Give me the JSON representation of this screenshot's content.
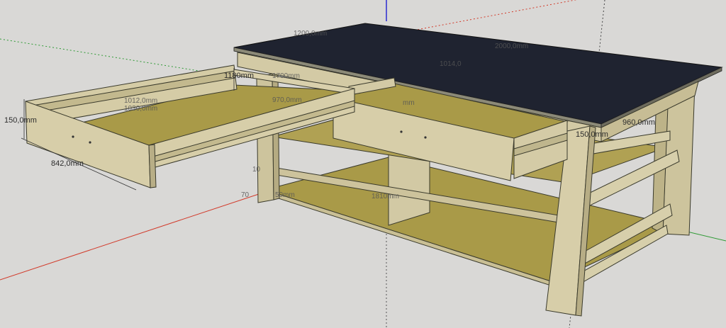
{
  "scene": {
    "background_color": "#d9d8d6",
    "axis_colors": {
      "red": "#d23a2a",
      "green": "#2f9a35",
      "blue": "#2a2ad0"
    },
    "wood_color": "#cfc6a2",
    "plywood_color": "#a99a48",
    "top_color": "#1f2330"
  },
  "dimensions": {
    "top_length": "1200,0mm",
    "top_length_2": "2000,0mm",
    "top_inner": "1014,0",
    "drawer_width_a": "1012,0mm",
    "drawer_width_b": "1030,0mm",
    "drawer_depth": "1180mm",
    "drawer_gap": "1700mm",
    "drawer_inner": "970,0mm",
    "drawer_height": "150,0mm",
    "drawer_length": "842,0mm",
    "leg_section": "150,0mm",
    "side_depth": "960,0mm",
    "right_drawer_label": "mm",
    "shelf_middle": "1810mm",
    "leg_height": "70mm",
    "shelf_gap": "10mm",
    "misc_a": "70",
    "misc_b": "50mm",
    "misc_c": "10"
  }
}
